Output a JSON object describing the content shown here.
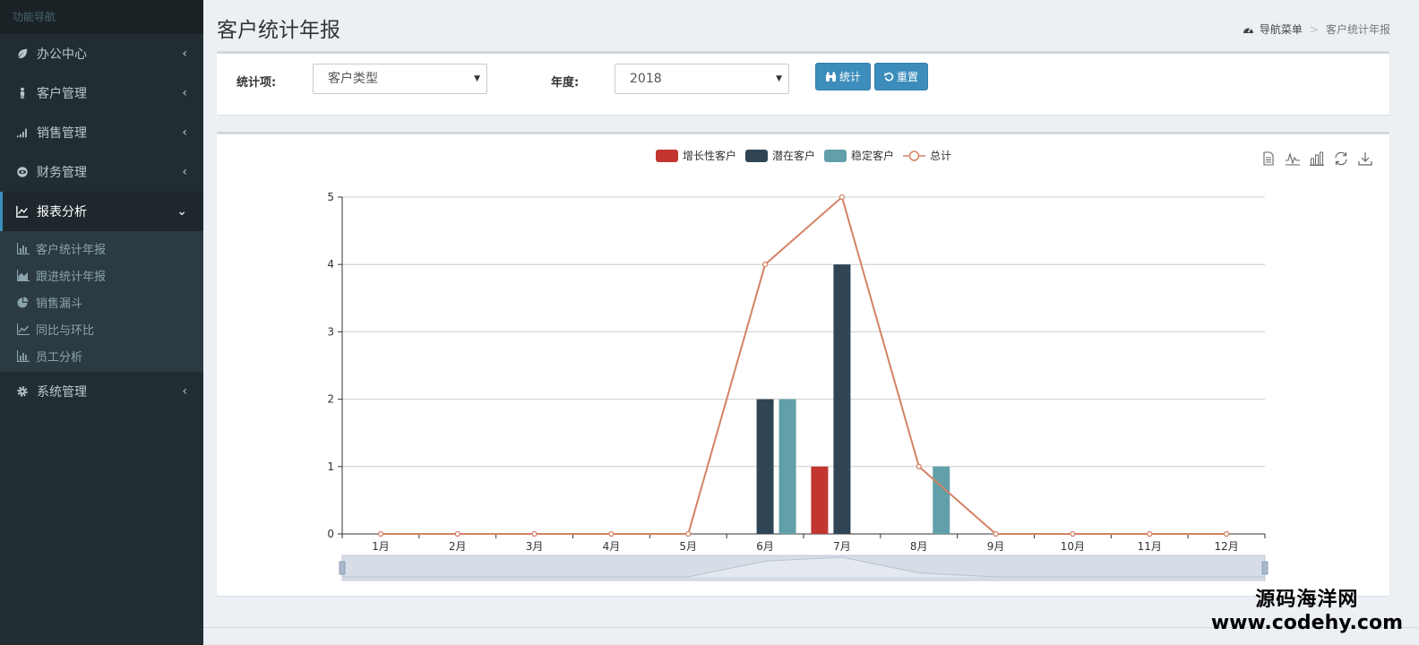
{
  "sidebar": {
    "header": "功能导航",
    "menus": [
      {
        "label": "办公中心",
        "icon": "leaf-icon"
      },
      {
        "label": "客户管理",
        "icon": "user-icon"
      },
      {
        "label": "销售管理",
        "icon": "signal-icon"
      },
      {
        "label": "财务管理",
        "icon": "eye-icon"
      },
      {
        "label": "报表分析",
        "icon": "line-chart-icon"
      },
      {
        "label": "系统管理",
        "icon": "gear-icon"
      }
    ],
    "submenu": [
      {
        "label": "客户统计年报",
        "icon": "bar-chart-icon"
      },
      {
        "label": "跟进统计年报",
        "icon": "area-chart-icon"
      },
      {
        "label": "销售漏斗",
        "icon": "pie-chart-icon"
      },
      {
        "label": "同比与环比",
        "icon": "line-chart-icon"
      },
      {
        "label": "员工分析",
        "icon": "bar-chart-icon"
      }
    ]
  },
  "header": {
    "title": "客户统计年报",
    "breadcrumb_home": "导航菜单",
    "breadcrumb_sep": ">",
    "breadcrumb_current": "客户统计年报"
  },
  "filter": {
    "item_label": "统计项:",
    "item_value": "客户类型",
    "year_label": "年度:",
    "year_value": "2018",
    "stat_button": "统计",
    "reset_button": "重置"
  },
  "colors": {
    "accent": "#3c8dbc",
    "sidebar_bg": "#222d32",
    "series_growth": "#c23531",
    "series_potential": "#2f4554",
    "series_stable": "#61a0a8",
    "series_total": "#d48265"
  },
  "chart_data": {
    "type": "bar",
    "categories": [
      "1月",
      "2月",
      "3月",
      "4月",
      "5月",
      "6月",
      "7月",
      "8月",
      "9月",
      "10月",
      "11月",
      "12月"
    ],
    "series": [
      {
        "name": "增长性客户",
        "type": "bar",
        "color": "#c23531",
        "values": [
          0,
          0,
          0,
          0,
          0,
          0,
          1,
          0,
          0,
          0,
          0,
          0
        ]
      },
      {
        "name": "潜在客户",
        "type": "bar",
        "color": "#2f4554",
        "values": [
          0,
          0,
          0,
          0,
          0,
          2,
          4,
          0,
          0,
          0,
          0,
          0
        ]
      },
      {
        "name": "稳定客户",
        "type": "bar",
        "color": "#61a0a8",
        "values": [
          0,
          0,
          0,
          0,
          0,
          2,
          0,
          1,
          0,
          0,
          0,
          0
        ]
      },
      {
        "name": "总计",
        "type": "line",
        "color": "#d48265",
        "values": [
          0,
          0,
          0,
          0,
          0,
          4,
          5,
          1,
          0,
          0,
          0,
          0
        ]
      }
    ],
    "yticks": [
      0,
      1,
      2,
      3,
      4,
      5
    ],
    "ylim": [
      0,
      5
    ],
    "grid": true,
    "legend": "top-center",
    "data_zoom": true
  },
  "toolbox": [
    "data-view-icon",
    "line-switch-icon",
    "bar-switch-icon",
    "restore-icon",
    "save-image-icon"
  ],
  "watermark": {
    "line1": "源码海洋网",
    "line2": "www.codehy.com"
  }
}
